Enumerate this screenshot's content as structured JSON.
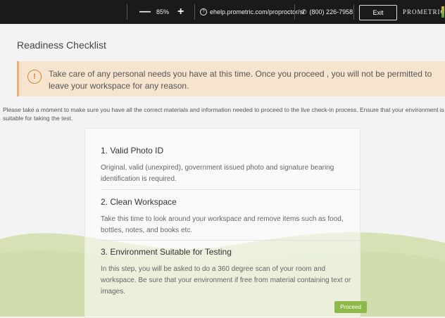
{
  "toolbar": {
    "zoom_out": "—",
    "zoom_level": "85%",
    "zoom_in": "+",
    "help_url": "ehelp.prometric.com/proproctor/s/",
    "phone": "(800) 226-7958",
    "exit_label": "Exit",
    "brand": "PROMETRIC"
  },
  "page": {
    "title": "Readiness Checklist",
    "alert": "Take care of any personal needs you have at this time. Once you proceed , you will not be permitted to leave your workspace for any reason.",
    "intro": "Please take a moment to make sure you have all the correct materials and information needed to proceed to the live check-in process. Ensure that your environment is suitable for taking the test."
  },
  "checklist": [
    {
      "title": "1. Valid Photo ID",
      "body": "Original, valid (unexpired), government issued photo and signature bearing identification is required."
    },
    {
      "title": "2. Clean Workspace",
      "body": "Take this time to look around your workspace and remove items such as food, bottles, notes, and books etc."
    },
    {
      "title": "3. Environment Suitable for Testing",
      "body": "In this step, you will be asked to do a 360 degree scan of your room and workspace. Be sure that your environment if free from material containing text or images."
    }
  ],
  "proceed_label": "Proceed",
  "colors": {
    "accent_green": "#8fb84a",
    "alert_bg": "#f6e4cf",
    "alert_icon": "#d98533"
  }
}
